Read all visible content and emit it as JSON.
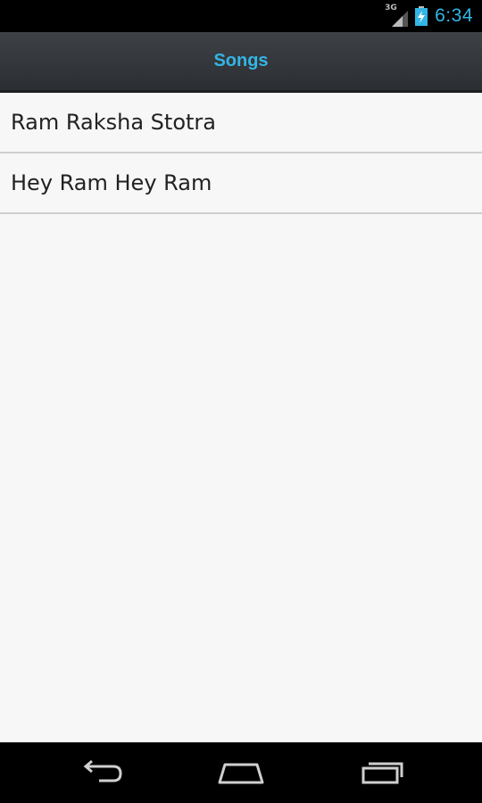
{
  "status_bar": {
    "network_type": "3G",
    "time": "6:34",
    "icons": [
      "signal-icon",
      "battery-charging-icon"
    ]
  },
  "action_bar": {
    "title": "Songs"
  },
  "songs": [
    {
      "title": "Ram Raksha Stotra"
    },
    {
      "title": "Hey Ram Hey Ram"
    }
  ],
  "nav_bar": {
    "icons": [
      "back-icon",
      "home-icon",
      "recent-apps-icon"
    ]
  },
  "colors": {
    "accent": "#33b5e5",
    "background": "#f7f7f7",
    "divider": "#cfcfcf"
  }
}
